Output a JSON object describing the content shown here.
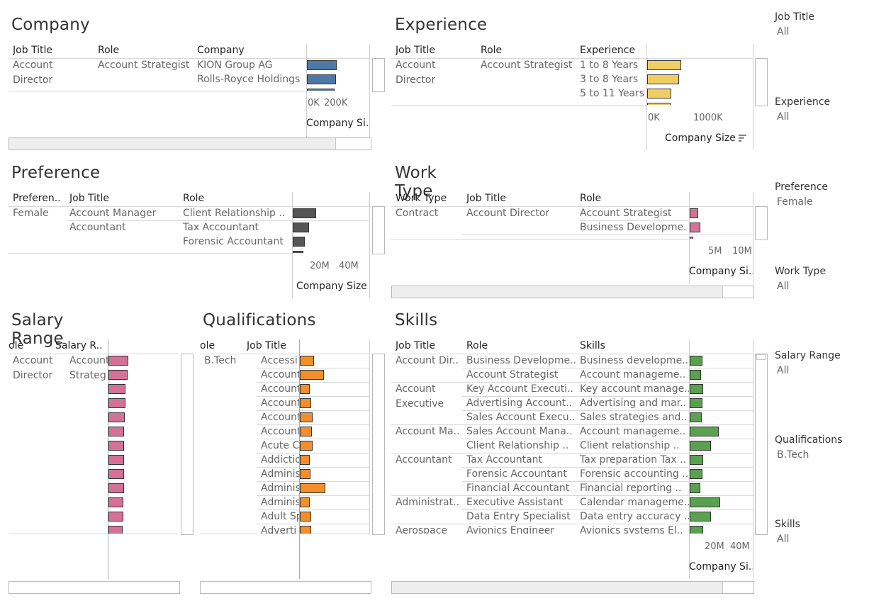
{
  "colors": {
    "company": "#4e79a7",
    "experience": "#f1ce63",
    "preference": "#555555",
    "worktype": "#d37295",
    "salary": "#d37295",
    "qualifications": "#f28e2b",
    "skills": "#59a14f"
  },
  "company": {
    "title": "Company",
    "headers": [
      "Job Title",
      "Role",
      "Company"
    ],
    "job_title": [
      "Account",
      "Director"
    ],
    "role": "Account Strategist",
    "rows": [
      "KION Group AG",
      "Rolls-Royce Holdings"
    ],
    "ticks": [
      "0K",
      "200K"
    ],
    "axis_title": "Company Si..",
    "bar_values": [
      0.78,
      0.75,
      0.72
    ]
  },
  "experience": {
    "title": "Experience",
    "headers": [
      "Job Title",
      "Role",
      "Experience"
    ],
    "job_title": [
      "Account",
      "Director"
    ],
    "role": "Account Strategist",
    "rows": [
      "1 to 8 Years",
      "3 to 8 Years",
      "5 to 11 Years"
    ],
    "ticks": [
      "0K",
      "1000K"
    ],
    "axis_title": "Company Size",
    "sort_icon": "sort-descending-icon",
    "bar_values": [
      0.72,
      0.68,
      0.52,
      0.5
    ]
  },
  "preference": {
    "title": "Preference",
    "headers": [
      "Preferen..",
      "Job Title",
      "Role"
    ],
    "preference": "Female",
    "groups": [
      {
        "job_title": "Account Manager",
        "roles": [
          "Client Relationship .."
        ]
      },
      {
        "job_title": "Accountant",
        "roles": [
          "Tax Accountant",
          "Forensic Accountant"
        ]
      }
    ],
    "ticks": [
      "20M",
      "40M"
    ],
    "axis_title": "Company Size",
    "bar_values": [
      0.62,
      0.42,
      0.32,
      0.28
    ]
  },
  "worktype": {
    "title": "Work Type",
    "headers": [
      "Work Type",
      "Job Title",
      "Role"
    ],
    "work_type": "Contract",
    "job_title": "Account Director",
    "rows": [
      "Account Strategist",
      "Business Developme.."
    ],
    "ticks": [
      "5M",
      "10M"
    ],
    "axis_title": "Company Si..",
    "bar_values": [
      0.22,
      0.28,
      0.1
    ]
  },
  "salary": {
    "title": "Salary Range",
    "headers": [
      "ole",
      "Salary R.."
    ],
    "job_title": [
      "Account",
      "Director"
    ],
    "rows": [
      "Account",
      "Strateg"
    ],
    "bar_values": [
      0.85,
      0.82,
      0.72,
      0.72,
      0.7,
      0.68,
      0.68,
      0.68,
      0.66,
      0.66,
      0.64,
      0.64,
      0.62
    ]
  },
  "qualifications": {
    "title": "Qualifications",
    "headers": [
      "ole",
      "Job Title"
    ],
    "qualification": "B.Tech",
    "rows": [
      "Accessi",
      "Account",
      "Account",
      "Account",
      "Account",
      "Account",
      "Acute C",
      "Addictio",
      "Adminis",
      "Adminis",
      "Adminis",
      "Adult Sp",
      "Adverti"
    ],
    "bar_values": [
      0.55,
      0.95,
      0.38,
      0.45,
      0.5,
      0.48,
      0.5,
      0.4,
      0.42,
      1.0,
      0.38,
      0.45,
      0.45
    ]
  },
  "skills": {
    "title": "Skills",
    "headers": [
      "Job Title",
      "Role",
      "Skills"
    ],
    "groups": [
      {
        "job_title": [
          "Account Dir.."
        ],
        "rows": [
          [
            "Business Developme..",
            "Business developme.."
          ],
          [
            "Account Strategist",
            "Account manageme.."
          ]
        ]
      },
      {
        "job_title": [
          "Account",
          "Executive"
        ],
        "rows": [
          [
            "Key Account Executi..",
            "Key account manage.."
          ],
          [
            "Advertising Account..",
            "Advertising and mar.."
          ],
          [
            "Sales Account Execu..",
            "Sales strategies and.."
          ]
        ]
      },
      {
        "job_title": [
          "Account Ma.."
        ],
        "rows": [
          [
            "Sales Account Mana..",
            "Account manageme.."
          ],
          [
            "Client Relationship ..",
            "Client relationship .."
          ]
        ]
      },
      {
        "job_title": [
          "Accountant"
        ],
        "rows": [
          [
            "Tax Accountant",
            "Tax preparation Tax .."
          ],
          [
            "Forensic Accountant",
            "Forensic accounting .."
          ],
          [
            "Financial Accountant",
            "Financial reporting .."
          ]
        ]
      },
      {
        "job_title": [
          "Administrat.."
        ],
        "rows": [
          [
            "Executive Assistant",
            "Calendar manageme.."
          ],
          [
            "Data Entry Specialist",
            "Data entry accuracy .."
          ]
        ]
      },
      {
        "job_title": [
          "Aerospace"
        ],
        "rows": [
          [
            "Avionics Engineer",
            "Avionics systems El.."
          ]
        ]
      }
    ],
    "ticks": [
      "20M",
      "40M"
    ],
    "axis_title": "Company Si..",
    "bar_values": [
      0.42,
      0.38,
      0.45,
      0.42,
      0.4,
      0.95,
      0.7,
      0.45,
      0.42,
      0.35,
      1.0,
      0.7,
      0.45
    ]
  },
  "filters": [
    {
      "label": "Job Title",
      "value": "All"
    },
    {
      "label": "Experience",
      "value": "All"
    },
    {
      "label": "Preference",
      "value": "Female"
    },
    {
      "label": "Work Type",
      "value": "All"
    },
    {
      "label": "Salary Range",
      "value": "All"
    },
    {
      "label": "Qualifications",
      "value": "B.Tech"
    },
    {
      "label": "Skills",
      "value": "All"
    }
  ]
}
